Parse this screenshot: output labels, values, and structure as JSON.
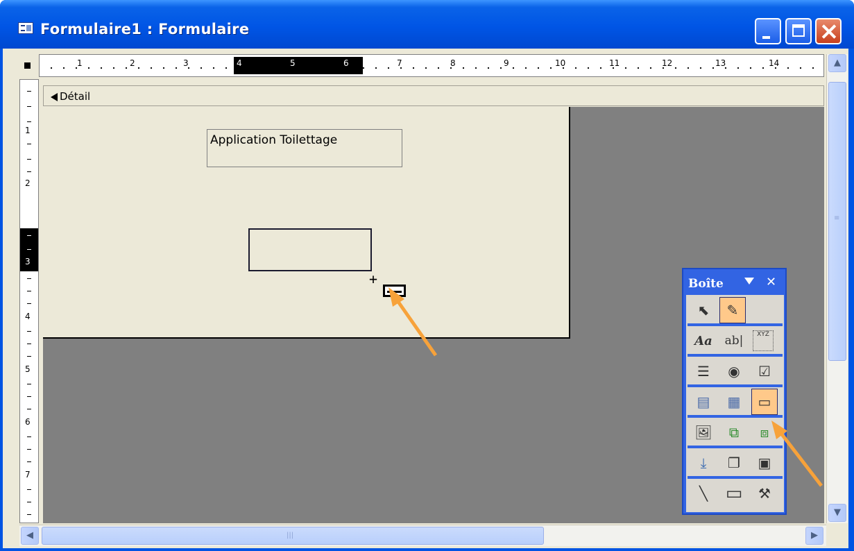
{
  "window": {
    "title": "Formulaire1 : Formulaire",
    "buttons": {
      "minimize": "minimize",
      "maximize": "maximize",
      "close": "close"
    }
  },
  "ruler_top": {
    "labels": [
      "1",
      "2",
      "3",
      "4",
      "5",
      "6",
      "7",
      "8",
      "9",
      "10",
      "11",
      "12",
      "13",
      "14"
    ],
    "highlight_from": "4",
    "highlight_to": "6"
  },
  "ruler_left": {
    "labels": [
      "1",
      "2",
      "3",
      "4",
      "5",
      "6",
      "7"
    ],
    "highlight": "3"
  },
  "section": {
    "label": "Détail"
  },
  "form": {
    "label_text": "Application Toilettage"
  },
  "toolbox": {
    "title": "Boîte",
    "close_glyph": "✕",
    "rows": [
      [
        {
          "icon": "pointer-icon",
          "glyph": "⬉"
        },
        {
          "icon": "control-wizard-icon",
          "glyph": "✎",
          "selected": true
        }
      ],
      [
        {
          "icon": "label-tool-icon",
          "glyph": "Aa"
        },
        {
          "icon": "textbox-tool-icon",
          "glyph": "ab|"
        },
        {
          "icon": "option-group-icon",
          "glyph": "XYZ"
        }
      ],
      [
        {
          "icon": "toggle-button-icon",
          "glyph": "☰"
        },
        {
          "icon": "option-button-icon",
          "glyph": "◉"
        },
        {
          "icon": "checkbox-tool-icon",
          "glyph": "☑"
        }
      ],
      [
        {
          "icon": "combobox-tool-icon",
          "glyph": "▤"
        },
        {
          "icon": "listbox-tool-icon",
          "glyph": "▦"
        },
        {
          "icon": "command-button-icon",
          "glyph": "▭",
          "selected": true
        }
      ],
      [
        {
          "icon": "image-tool-icon",
          "glyph": "🖼"
        },
        {
          "icon": "unbound-object-frame-icon",
          "glyph": "⧉"
        },
        {
          "icon": "bound-object-frame-icon",
          "glyph": "⧈"
        }
      ],
      [
        {
          "icon": "page-break-icon",
          "glyph": "⤓"
        },
        {
          "icon": "tab-control-icon",
          "glyph": "❐"
        },
        {
          "icon": "subform-tool-icon",
          "glyph": "▣"
        }
      ],
      [
        {
          "icon": "line-tool-icon",
          "glyph": "╲"
        },
        {
          "icon": "rectangle-tool-icon",
          "glyph": "▭"
        },
        {
          "icon": "more-controls-icon",
          "glyph": "⚒"
        }
      ]
    ]
  },
  "colors": {
    "titlebar": "#0055e5",
    "form_bg": "#ece9d8",
    "canvas_gray": "#808080",
    "selected_tool": "#ffc98a",
    "arrow": "#f7a23a"
  }
}
